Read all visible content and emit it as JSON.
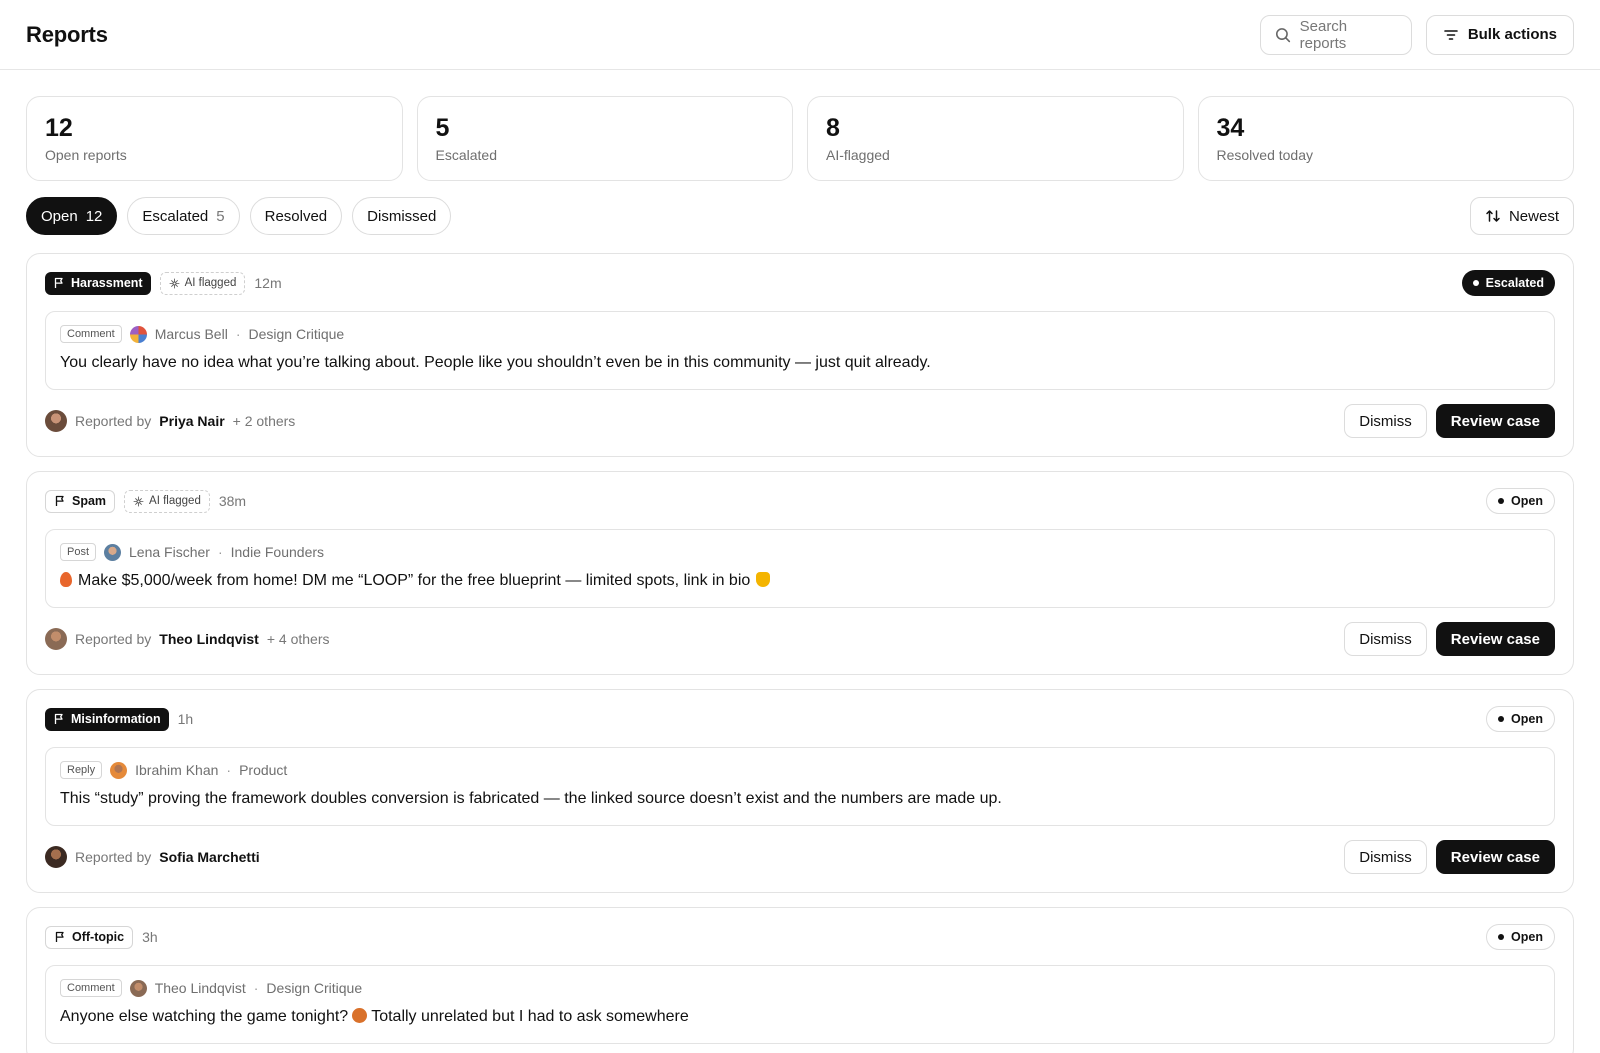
{
  "header": {
    "title": "Reports",
    "search_placeholder": "Search reports",
    "bulk_label": "Bulk actions"
  },
  "stats": [
    {
      "value": "12",
      "label": "Open reports"
    },
    {
      "value": "5",
      "label": "Escalated"
    },
    {
      "value": "8",
      "label": "AI-flagged"
    },
    {
      "value": "34",
      "label": "Resolved today"
    }
  ],
  "filters": {
    "tabs": [
      {
        "label": "Open",
        "count": "12"
      },
      {
        "label": "Escalated",
        "count": "5"
      },
      {
        "label": "Resolved"
      },
      {
        "label": "Dismissed"
      }
    ],
    "sort_label": "Newest"
  },
  "actions": {
    "dismiss": "Dismiss",
    "review": "Review case"
  },
  "reported_by_label": "Reported by",
  "reports": [
    {
      "category": "Harassment",
      "ai_flag": "AI flagged",
      "time": "12m",
      "status": "Escalated",
      "content_type": "Comment",
      "author": "Marcus Bell",
      "community": "Design Critique",
      "text": "You clearly have no idea what you’re talking about. People like you shouldn’t even be in this community — just quit already.",
      "reporter": "Priya Nair",
      "others": "+ 2 others"
    },
    {
      "category": "Spam",
      "ai_flag": "AI flagged",
      "time": "38m",
      "status": "Open",
      "content_type": "Post",
      "author": "Lena Fischer",
      "community": "Indie Founders",
      "text": "Make $5,000/week from home! DM me “LOOP” for the free blueprint — limited spots, link in bio",
      "reporter": "Theo Lindqvist",
      "others": "+ 4 others"
    },
    {
      "category": "Misinformation",
      "time": "1h",
      "status": "Open",
      "content_type": "Reply",
      "author": "Ibrahim Khan",
      "community": "Product",
      "text": "This “study” proving the framework doubles conversion is fabricated — the linked source doesn’t exist and the numbers are made up.",
      "reporter": "Sofia Marchetti"
    },
    {
      "category": "Off-topic",
      "time": "3h",
      "status": "Open",
      "content_type": "Comment",
      "author": "Theo Lindqvist",
      "community": "Design Critique",
      "text_before": "Anyone else watching the game tonight?",
      "text_after": "Totally unrelated but I had to ask somewhere"
    }
  ],
  "colors": {
    "ink": "#111111",
    "border": "#e3e3e3",
    "muted": "#777777"
  },
  "icons": [
    "search-icon",
    "filter-icon",
    "sort-icon",
    "flag-icon",
    "sparkle-icon"
  ]
}
